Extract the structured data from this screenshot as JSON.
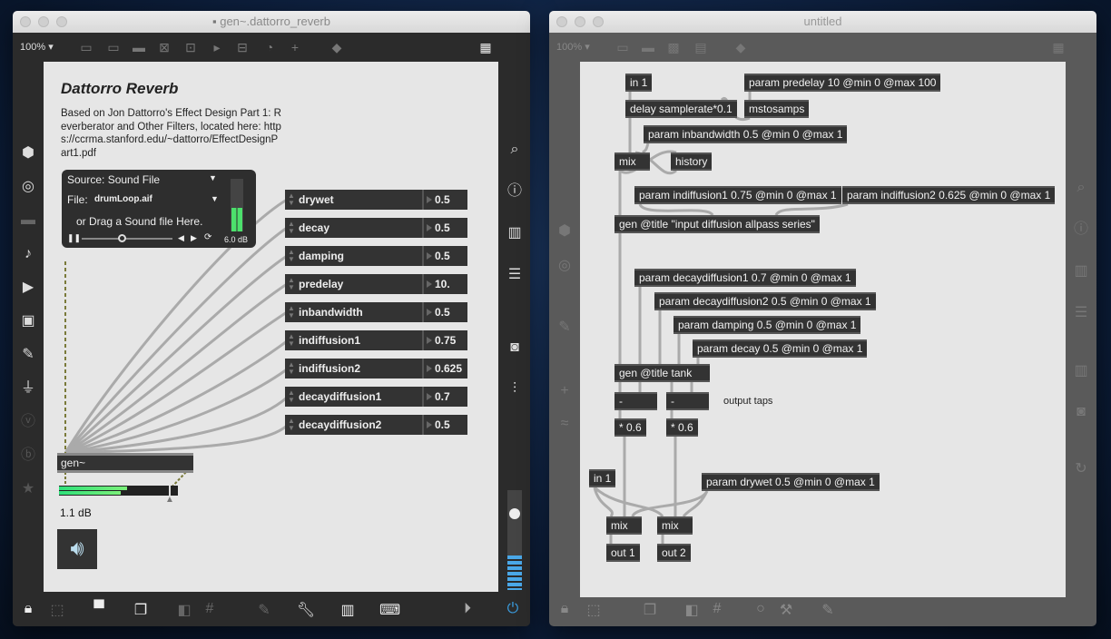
{
  "left_window": {
    "title": "gen~.dattorro_reverb",
    "zoom": "100%",
    "patch_title": "Dattorro Reverb",
    "description": "Based on Jon Dattorro's Effect Design Part 1: Reverberator and Other Filters, located here: https://ccrma.stanford.edu/~dattorro/EffectDesignPart1.pdf",
    "playlist": {
      "source": "Source: Sound File",
      "file_label": "File:",
      "file": "drumLoop.aif",
      "drag_hint": "or Drag a Sound file Here.",
      "gain": "6.0 dB",
      "position": 0.45
    },
    "params": [
      {
        "name": "drywet",
        "value": "0.5"
      },
      {
        "name": "decay",
        "value": "0.5"
      },
      {
        "name": "damping",
        "value": "0.5"
      },
      {
        "name": "predelay",
        "value": "10."
      },
      {
        "name": "inbandwidth",
        "value": "0.5"
      },
      {
        "name": "indiffusion1",
        "value": "0.75"
      },
      {
        "name": "indiffusion2",
        "value": "0.625"
      },
      {
        "name": "decaydiffusion1",
        "value": "0.7"
      },
      {
        "name": "decaydiffusion2",
        "value": "0.5"
      }
    ],
    "gen_object": "gen~",
    "meter_level": [
      0.57,
      0.52
    ],
    "gain_readout": "1.1 dB",
    "output_gain": 0.7
  },
  "right_window": {
    "title": "untitled",
    "zoom": "100%",
    "objects": {
      "in1_top": "in 1",
      "param_predelay": "param predelay 10 @min 0 @max 100",
      "delay": "delay samplerate*0.1",
      "mstosamps": "mstosamps",
      "param_inbandwidth": "param inbandwidth 0.5 @min 0 @max 1",
      "mix_top": "mix",
      "history": "history",
      "param_indiffusion1": "param indiffusion1 0.75 @min 0 @max 1",
      "param_indiffusion2": "param indiffusion2 0.625 @min 0 @max 1",
      "gen_input": "gen @title \"input diffusion allpass series\"",
      "param_decaydiffusion1": "param decaydiffusion1 0.7 @min 0 @max 1",
      "param_decaydiffusion2": "param decaydiffusion2 0.5 @min 0 @max 1",
      "param_damping": "param damping 0.5 @min 0 @max 1",
      "param_decay": "param decay 0.5 @min 0 @max 1",
      "gen_tank": "gen @title tank",
      "minus_l": "-",
      "minus_r": "-",
      "mul_l": "* 0.6",
      "mul_r": "* 0.6",
      "in1_bottom": "in 1",
      "param_drywet": "param drywet 0.5 @min 0 @max 1",
      "mix_l": "mix",
      "mix_r": "mix",
      "out1": "out 1",
      "out2": "out 2"
    },
    "comment": "output taps"
  }
}
